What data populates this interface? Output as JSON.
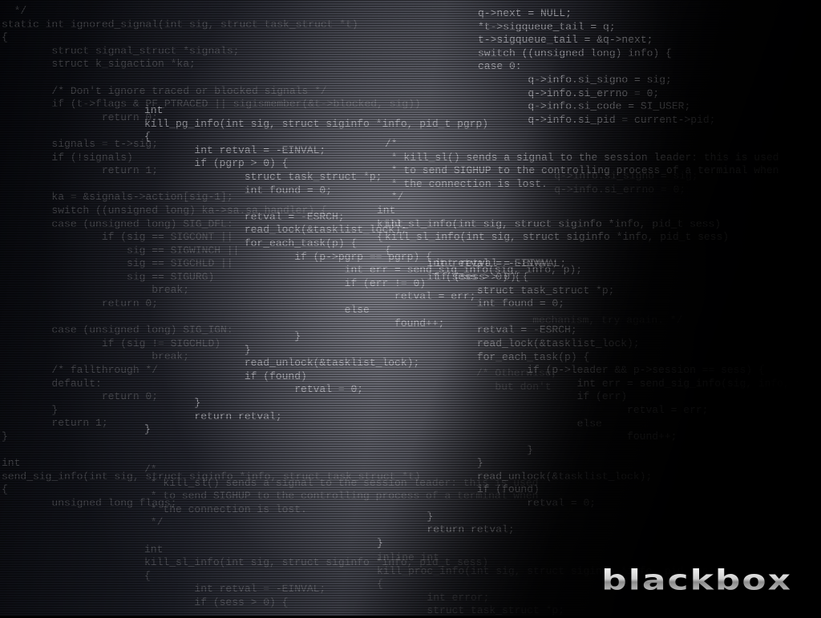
{
  "layers": {
    "a": [
      "  */",
      "static int ignored_signal(int sig, struct task_struct *t)",
      "{",
      "        struct signal_struct *signals;",
      "        struct k_sigaction *ka;",
      "",
      "        /* Don't ignore traced or blocked signals */",
      "        if (t->flags & PF_PTRACED || sigismember(&t->blocked, sig))",
      "                return 0;",
      "",
      "        signals = t->sig;",
      "        if (!signals)",
      "                return 1;",
      "",
      "        ka = &signals->action[sig-1];",
      "        switch ((unsigned long) ka->sa.sa_handler) {",
      "        case (unsigned long) SIG_DFL:",
      "                if (sig == SIGCONT ||",
      "                    sig == SIGWINCH ||",
      "                    sig == SIGCHLD ||",
      "                    sig == SIGURG)",
      "                        break;",
      "                return 0;",
      "",
      "        case (unsigned long) SIG_IGN:",
      "                if (sig != SIGCHLD)",
      "                        break;",
      "        /* fallthrough */",
      "        default:",
      "                return 0;",
      "        }",
      "        return 1;",
      "}",
      "",
      "int",
      "send_sig_info(int sig, struct siginfo *info, struct task_struct *t)",
      "{",
      "        unsigned long flags;"
    ],
    "b": [
      "int",
      "kill_pg_info(int sig, struct siginfo *info, pid_t pgrp)",
      "{",
      "        int retval = -EINVAL;",
      "        if (pgrp > 0) {",
      "                struct task_struct *p;",
      "                int found = 0;",
      "",
      "                retval = -ESRCH;",
      "                read_lock(&tasklist_lock);",
      "                for_each_task(p) {",
      "                        if (p->pgrp == pgrp) {",
      "                                int err = send_sig_info(sig, info, p);",
      "                                if (err != 0)",
      "                                        retval = err;",
      "                                else",
      "                                        found++;",
      "                        }",
      "                }",
      "                read_unlock(&tasklist_lock);",
      "                if (found)",
      "                        retval = 0;",
      "        }",
      "        return retval;",
      "}"
    ],
    "c": [
      "/*",
      " * kill_sl() sends a signal to the session leader: this is used",
      " * to send SIGHUP to the controlling process of a terminal when",
      " * the connection is lost.",
      " */",
      "",
      "int",
      "kill_sl_info(int sig, struct siginfo *info, pid_t sess)",
      "{",
      "        int retval = -EINVAL;",
      "        if (sess > 0) {"
    ],
    "d": [
      "q->next = NULL;",
      "*t->sigqueue_tail = q;",
      "t->sigqueue_tail = &q->next;",
      "switch ((unsigned long) info) {",
      "case 0:",
      "        q->info.si_signo = sig;",
      "        q->info.si_errno = 0;",
      "        q->info.si_code = SI_USER;",
      "        q->info.si_pid = current->pid;"
    ],
    "e": [
      "                        q->info.si_signo = sig;",
      "                        q->info.si_errno = 0;"
    ],
    "f": [
      "int",
      "kill_sl_info(int sig, struct siginfo *info, pid_t sess)",
      "{",
      "",
      "        int retval = -EINVAL;",
      "        if (sess > 0) {",
      "                struct task_struct *p;",
      "                int found = 0;",
      "",
      "                retval = -ESRCH;",
      "                read_lock(&tasklist_lock);",
      "                for_each_task(p) {",
      "                        if (p->leader && p->session == sess) {",
      "                                int err = send_sig_info(sig, info, p);",
      "                                if (err)",
      "                                        retval = err;",
      "                                else",
      "                                        found++;",
      "                        }",
      "                }",
      "                read_unlock(&tasklist_lock);",
      "                if (found)",
      "                        retval = 0;",
      "        }",
      "        return retval;",
      "}"
    ],
    "g": [
      "         mechanism, try again. */",
      "",
      "",
      "",
      "/* Otherwise,",
      "   but don't"
    ],
    "h": [
      "/*",
      " * kill_sl() sends a signal to the session leader: this is used",
      " * to send SIGHUP to the controlling process of a terminal when",
      " * the connection is lost.",
      " */",
      "",
      "int",
      "kill_sl_info(int sig, struct siginfo *info, pid_t sess)",
      "{",
      "        int retval = -EINVAL;",
      "        if (sess > 0) {"
    ],
    "i": [
      "inline int",
      "kill_proc_info(int sig, struct siginfo *info, pid_t pid)",
      "{",
      "        int error;",
      "        struct task_struct *p;"
    ]
  },
  "logo": {
    "text": "blackbox"
  }
}
